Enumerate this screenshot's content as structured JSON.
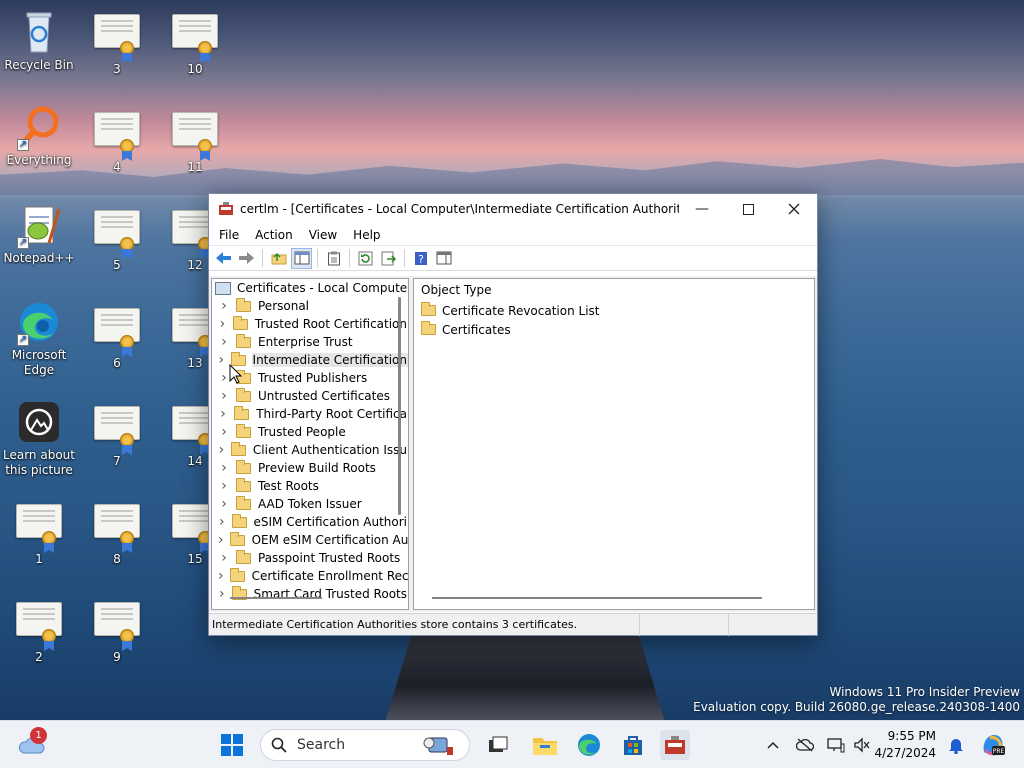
{
  "desktop": {
    "icons": [
      {
        "label": "Recycle Bin",
        "icon": "recycle-bin-icon"
      },
      {
        "label": "Everything",
        "icon": "magnifier-icon"
      },
      {
        "label": "Notepad++",
        "icon": "notepad-plus-plus-icon"
      },
      {
        "label": "Microsoft Edge",
        "icon": "edge-icon"
      },
      {
        "label": "Learn about this picture",
        "icon": "camera-icon"
      },
      {
        "label": "1"
      },
      {
        "label": "2"
      },
      {
        "label": "3"
      },
      {
        "label": "4"
      },
      {
        "label": "5"
      },
      {
        "label": "6"
      },
      {
        "label": "7"
      },
      {
        "label": "8"
      },
      {
        "label": "9"
      },
      {
        "label": "10"
      },
      {
        "label": "11"
      },
      {
        "label": "12"
      },
      {
        "label": "13"
      },
      {
        "label": "14"
      },
      {
        "label": "15"
      }
    ]
  },
  "window": {
    "title": "certlm - [Certificates - Local Computer\\Intermediate Certification Authorities]",
    "menu": [
      "File",
      "Action",
      "View",
      "Help"
    ],
    "tree": {
      "root": "Certificates - Local Computer",
      "items": [
        "Personal",
        "Trusted Root Certification",
        "Enterprise Trust",
        "Intermediate Certification",
        "Trusted Publishers",
        "Untrusted Certificates",
        "Third-Party Root Certifica",
        "Trusted People",
        "Client Authentication Issu",
        "Preview Build Roots",
        "Test Roots",
        "AAD Token Issuer",
        "eSIM Certification Authori",
        "OEM eSIM Certification Au",
        "Passpoint Trusted Roots",
        "Certificate Enrollment Rec",
        "Smart Card Trusted Roots"
      ],
      "selected_index": 3
    },
    "list": {
      "column": "Object Type",
      "items": [
        "Certificate Revocation List",
        "Certificates"
      ]
    },
    "status": "Intermediate Certification Authorities store contains 3 certificates."
  },
  "watermark": {
    "line1": "Windows 11 Pro Insider Preview",
    "line2": "Evaluation copy. Build 26080.ge_release.240308-1400"
  },
  "taskbar": {
    "search_placeholder": "Search",
    "weather_badge": "1",
    "time": "9:55 PM",
    "date": "4/27/2024"
  }
}
